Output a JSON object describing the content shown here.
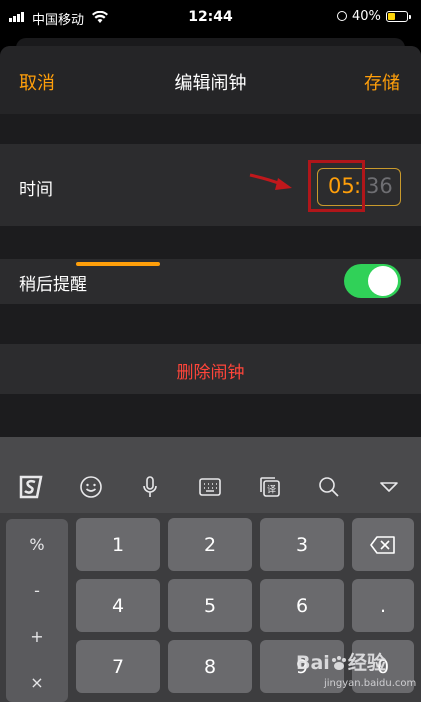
{
  "status_bar": {
    "carrier": "中国移动",
    "time": "12:44",
    "battery_percent": "40%",
    "battery_level": 0.4,
    "battery_color": "#ffd60a"
  },
  "nav": {
    "cancel_label": "取消",
    "title": "编辑闹钟",
    "save_label": "存储"
  },
  "time_row": {
    "label": "时间",
    "hour": "05",
    "separator": ":",
    "minute": "36"
  },
  "snooze_row": {
    "label": "稍后提醒",
    "enabled": true
  },
  "delete_button": {
    "label": "删除闹钟"
  },
  "keyboard": {
    "toolbar_icons": [
      "sogou-logo-icon",
      "emoji-icon",
      "microphone-icon",
      "keyboard-icon",
      "translate-icon",
      "search-icon",
      "collapse-icon"
    ],
    "symbol_column": [
      "%",
      "-",
      "+",
      "×"
    ],
    "keys": [
      "1",
      "2",
      "3",
      "4",
      "5",
      "6",
      "7",
      "8",
      "9"
    ],
    "dot_key": ".",
    "zero_key": "0"
  },
  "watermark": {
    "logo_text": "Bai",
    "logo_suffix": "经验",
    "url": "jingyan.baidu.com"
  },
  "colors": {
    "accent": "#ff9f0a",
    "destructive": "#ff453a",
    "toggle_on": "#30d158",
    "highlight_annotation": "#b0161a"
  }
}
